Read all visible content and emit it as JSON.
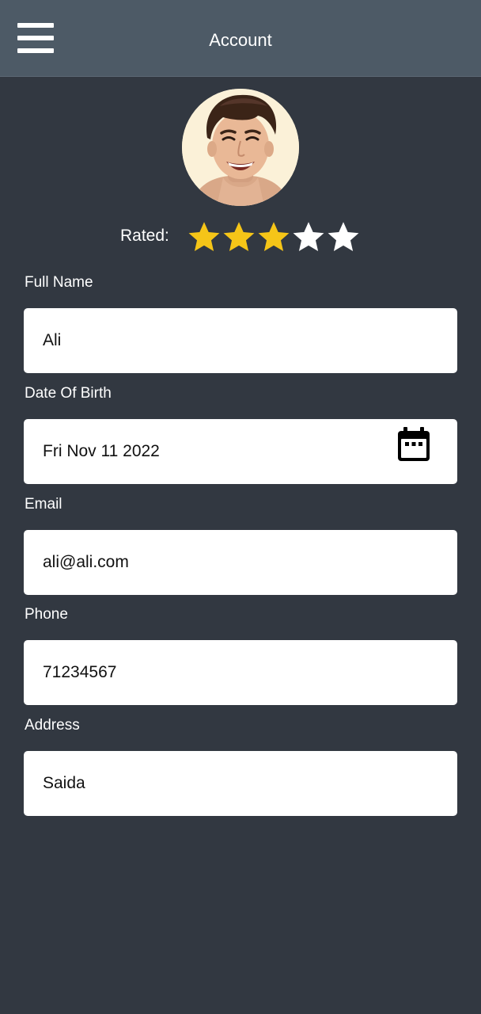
{
  "header": {
    "title": "Account",
    "menu_icon": "hamburger-menu-icon"
  },
  "profile": {
    "avatar_icon": "user-avatar-photo",
    "rating_label": "Rated:",
    "rating_value": 3,
    "rating_max": 5,
    "star_filled_color": "#f5c518",
    "star_empty_color": "#ffffff"
  },
  "form": {
    "full_name": {
      "label": "Full Name",
      "value": "Ali"
    },
    "date_of_birth": {
      "label": "Date Of Birth",
      "value": "Fri Nov 11 2022",
      "icon": "calendar-icon"
    },
    "email": {
      "label": "Email",
      "value": "ali@ali.com"
    },
    "phone": {
      "label": "Phone",
      "value": "71234567"
    },
    "address": {
      "label": "Address",
      "value": "Saida"
    }
  },
  "colors": {
    "background": "#323841",
    "header": "#4d5a66",
    "field": "#ffffff"
  }
}
